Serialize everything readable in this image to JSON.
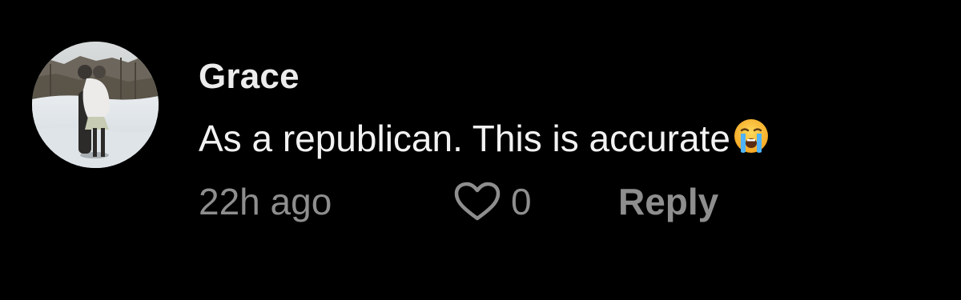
{
  "comment": {
    "username": "Grace",
    "text": "As a republican. This is accurate",
    "emoji": "loudly-crying-face-icon",
    "timestamp": "22h ago",
    "like_count": "0",
    "reply_label": "Reply"
  },
  "colors": {
    "background": "#000000",
    "username": "#ececec",
    "text": "#f2f2f2",
    "muted": "#8e8e8e"
  }
}
